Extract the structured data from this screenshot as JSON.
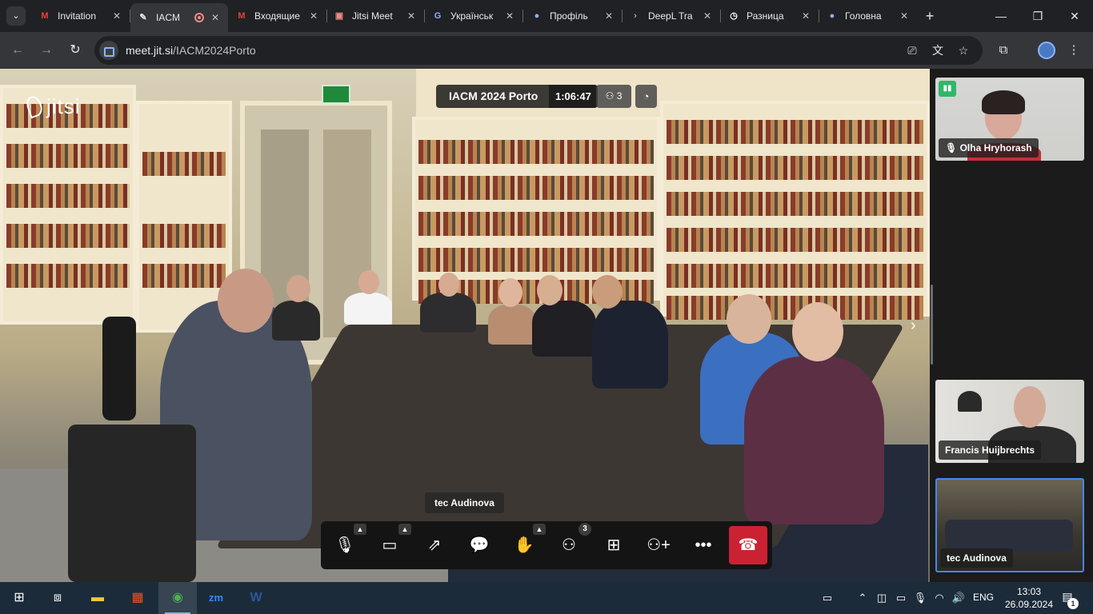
{
  "browser": {
    "tabs": [
      {
        "title": "Invitation",
        "icon": "gmail-icon",
        "icon_glyph": "M",
        "icon_color": "#ea4335"
      },
      {
        "title": "IACM",
        "icon": "jitsi-icon",
        "icon_glyph": "✎",
        "icon_color": "#e8eaed",
        "active": true,
        "recording": true
      },
      {
        "title": "Входящие",
        "icon": "gmail-icon",
        "icon_glyph": "M",
        "icon_color": "#ea4335"
      },
      {
        "title": "Jitsi Meet",
        "icon": "jitsi-meet-icon",
        "icon_glyph": "▣",
        "icon_color": "#f28b82"
      },
      {
        "title": "Українськ",
        "icon": "google-icon",
        "icon_glyph": "G",
        "icon_color": "#8ab4f8"
      },
      {
        "title": "Профіль",
        "icon": "globe-icon",
        "icon_glyph": "●",
        "icon_color": "#8ab4f8"
      },
      {
        "title": "DeepL Tra",
        "icon": "deepl-icon",
        "icon_glyph": "›",
        "icon_color": "#8ab4f8"
      },
      {
        "title": "Разница",
        "icon": "clock-icon",
        "icon_glyph": "◷",
        "icon_color": "#ffffff"
      },
      {
        "title": "Головна",
        "icon": "globe-icon",
        "icon_glyph": "●",
        "icon_color": "#8ab4f8"
      }
    ],
    "close_glyph": "✕",
    "new_tab_glyph": "+",
    "url_host": "meet.jit.si",
    "url_path": "/IACM2024Porto"
  },
  "meeting": {
    "logo_text": "jitsi",
    "conference_name": "IACM 2024 Porto",
    "timer": "1:06:47",
    "participant_count": "3",
    "dominant_speaker": "tec Audinova",
    "toolbar_participants_badge": "3",
    "thumbnails": [
      {
        "name": "Olha Hryhorash",
        "muted": true
      },
      {
        "name": "Francis Huijbrechts"
      },
      {
        "name": "tec Audinova",
        "selected": true
      }
    ]
  },
  "taskbar": {
    "language": "ENG",
    "time": "13:03",
    "date": "26.09.2024",
    "notifications_count": "1",
    "apps": [
      "start-icon",
      "task-view-icon",
      "file-explorer-icon",
      "store-icon",
      "chrome-icon",
      "zoom-icon",
      "word-icon"
    ]
  },
  "colors": {
    "hangup": "#cb2233",
    "selected_border": "#4687ed",
    "signal_good": "#31b76a"
  }
}
